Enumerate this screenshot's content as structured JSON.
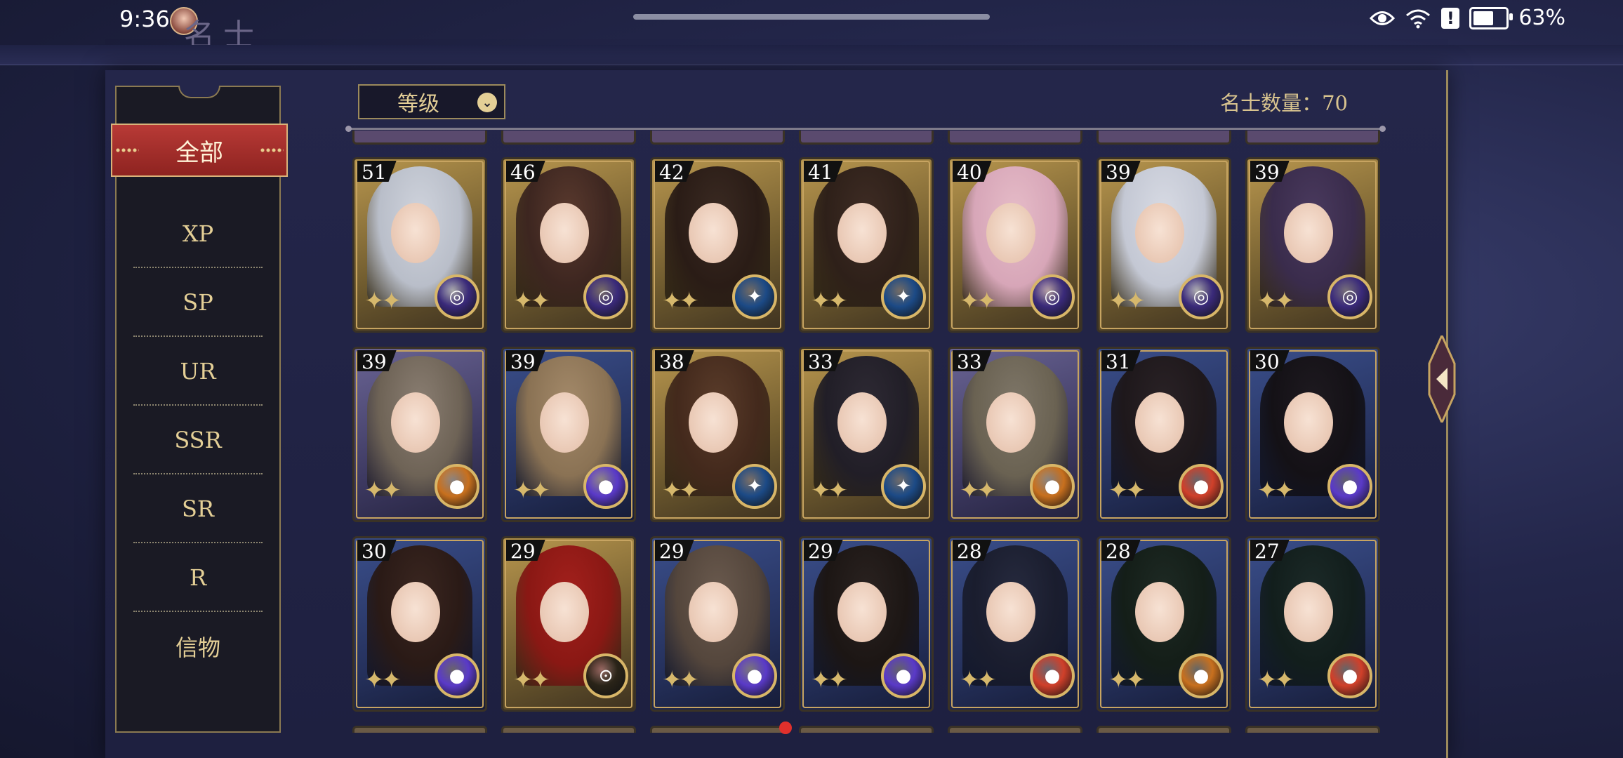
{
  "status_bar": {
    "time": "9:36",
    "battery_text": "63%",
    "battery_level": 0.63
  },
  "page": {
    "title": "名士"
  },
  "sidebar": {
    "items": [
      {
        "label": "全部",
        "active": true
      },
      {
        "label": "XP"
      },
      {
        "label": "SP"
      },
      {
        "label": "UR"
      },
      {
        "label": "SSR"
      },
      {
        "label": "SR"
      },
      {
        "label": "R"
      },
      {
        "label": "信物"
      }
    ]
  },
  "sort": {
    "selected": "等级"
  },
  "count": {
    "label": "名士数量：70"
  },
  "cards": [
    {
      "level": "51",
      "frame": "gold",
      "emblem": "purple-swirl-icon",
      "portrait": "#cfd3dc",
      "hair": "#b9bec9"
    },
    {
      "level": "46",
      "frame": "gold",
      "emblem": "purple-swirl-icon",
      "portrait": "#5a3a2e",
      "hair": "#3d2620"
    },
    {
      "level": "42",
      "frame": "gold",
      "emblem": "blue-compass-icon",
      "portrait": "#3a2a22",
      "hair": "#2a1c16"
    },
    {
      "level": "41",
      "frame": "gold",
      "emblem": "blue-compass-icon",
      "portrait": "#3e2c24",
      "hair": "#2e2019"
    },
    {
      "level": "40",
      "frame": "gold",
      "emblem": "purple-swirl-icon",
      "portrait": "#e6bcc8",
      "hair": "#d7a6b8"
    },
    {
      "level": "39",
      "frame": "gold",
      "emblem": "purple-swirl-icon",
      "portrait": "#d8dbe4",
      "hair": "#c4c8d4"
    },
    {
      "level": "39",
      "frame": "gold",
      "emblem": "purple-swirl-icon",
      "portrait": "#4a3a5e",
      "hair": "#3a2c4c"
    },
    {
      "level": "39",
      "frame": "purple",
      "emblem": "orange-orb-icon",
      "portrait": "#8a7e72",
      "hair": "#6e6356"
    },
    {
      "level": "39",
      "frame": "blue",
      "emblem": "violet-orb-icon",
      "portrait": "#a48a6a",
      "hair": "#8a7254"
    },
    {
      "level": "38",
      "frame": "gold",
      "emblem": "blue-compass-icon",
      "portrait": "#5a3c2a",
      "hair": "#43291c"
    },
    {
      "level": "33",
      "frame": "gold",
      "emblem": "blue-compass-icon",
      "portrait": "#2e2a34",
      "hair": "#211e27"
    },
    {
      "level": "33",
      "frame": "purple",
      "emblem": "orange-orb-icon",
      "portrait": "#7e7668",
      "hair": "#6a6252"
    },
    {
      "level": "31",
      "frame": "blue",
      "emblem": "red-orb-icon",
      "portrait": "#2a2226",
      "hair": "#1e181b"
    },
    {
      "level": "30",
      "frame": "blue",
      "emblem": "violet-orb-icon",
      "portrait": "#1e1a20",
      "hair": "#141116"
    },
    {
      "level": "30",
      "frame": "blue",
      "emblem": "violet-orb-icon",
      "portrait": "#3a2620",
      "hair": "#2a1a16"
    },
    {
      "level": "29",
      "frame": "gold",
      "emblem": "gold-compass-icon",
      "portrait": "#a3201c",
      "hair": "#8a1814"
    },
    {
      "level": "29",
      "frame": "blue",
      "emblem": "violet-orb-icon",
      "portrait": "#6a5a4e",
      "hair": "#54463c"
    },
    {
      "level": "29",
      "frame": "blue",
      "emblem": "violet-orb-icon",
      "portrait": "#2a2220",
      "hair": "#1c1614"
    },
    {
      "level": "28",
      "frame": "blue",
      "emblem": "red-orb-icon",
      "portrait": "#262a3e",
      "hair": "#1a1d2e"
    },
    {
      "level": "28",
      "frame": "blue",
      "emblem": "orange-orb-icon",
      "portrait": "#1e2a24",
      "hair": "#141e18"
    },
    {
      "level": "27",
      "frame": "blue",
      "emblem": "red-orb-icon",
      "portrait": "#1c2a28",
      "hair": "#121e1c"
    }
  ],
  "colors": {
    "frame_gold": "#8a6e3a",
    "frame_purple": "#4a4570",
    "frame_blue": "#2c3a66",
    "accent_red": "#b83a36",
    "text_gold": "#e4cf96"
  }
}
